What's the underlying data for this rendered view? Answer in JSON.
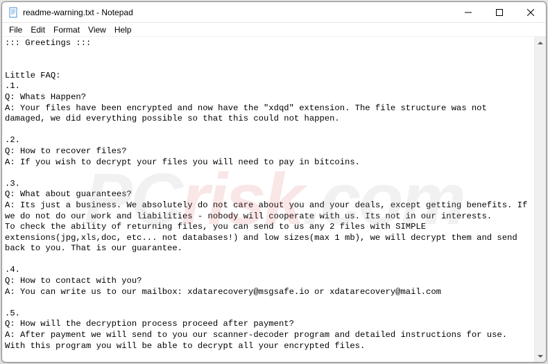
{
  "window": {
    "title": "readme-warning.txt - Notepad"
  },
  "menu": {
    "file": "File",
    "edit": "Edit",
    "format": "Format",
    "view": "View",
    "help": "Help"
  },
  "content": {
    "text": "::: Greetings :::\n\n\nLittle FAQ:\n.1.\nQ: Whats Happen?\nA: Your files have been encrypted and now have the \"xdqd\" extension. The file structure was not damaged, we did everything possible so that this could not happen.\n\n.2.\nQ: How to recover files?\nA: If you wish to decrypt your files you will need to pay in bitcoins.\n\n.3.\nQ: What about guarantees?\nA: Its just a business. We absolutely do not care about you and your deals, except getting benefits. If we do not do our work and liabilities - nobody will cooperate with us. Its not in our interests.\nTo check the ability of returning files, you can send to us any 2 files with SIMPLE extensions(jpg,xls,doc, etc... not databases!) and low sizes(max 1 mb), we will decrypt them and send back to you. That is our guarantee.\n\n.4.\nQ: How to contact with you?\nA: You can write us to our mailbox: xdatarecovery@msgsafe.io or xdatarecovery@mail.com\n\n.5.\nQ: How will the decryption process proceed after payment?\nA: After payment we will send to you our scanner-decoder program and detailed instructions for use. With this program you will be able to decrypt all your encrypted files."
  },
  "watermark": {
    "p": "PC",
    "r": "risk",
    "c": ".com"
  }
}
